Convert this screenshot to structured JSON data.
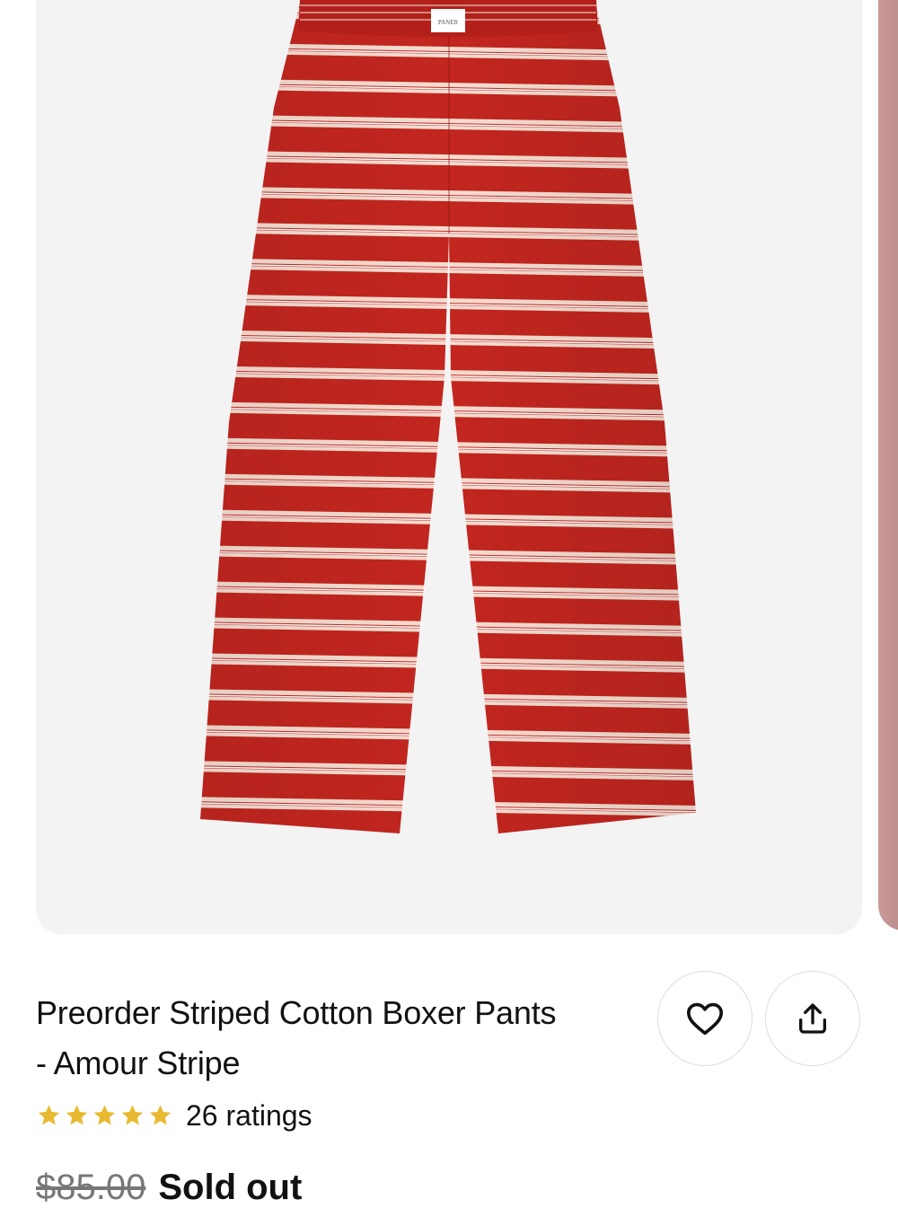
{
  "product": {
    "title_line1": "Preorder Striped Cotton Boxer Pants",
    "title_line2": "- Amour Stripe",
    "rating_value": 5,
    "rating_text": "26 ratings",
    "original_price": "$85.00",
    "status": "Sold out",
    "waistband_label": "PANER"
  },
  "colors": {
    "fabric_red": "#c2261f",
    "stripe_cream": "#f4dccf",
    "star_gold": "#e8b931",
    "gallery_bg": "#f4f3f4"
  },
  "icons": {
    "favorite": "heart-icon",
    "share": "share-icon",
    "rating": "star-icon"
  }
}
